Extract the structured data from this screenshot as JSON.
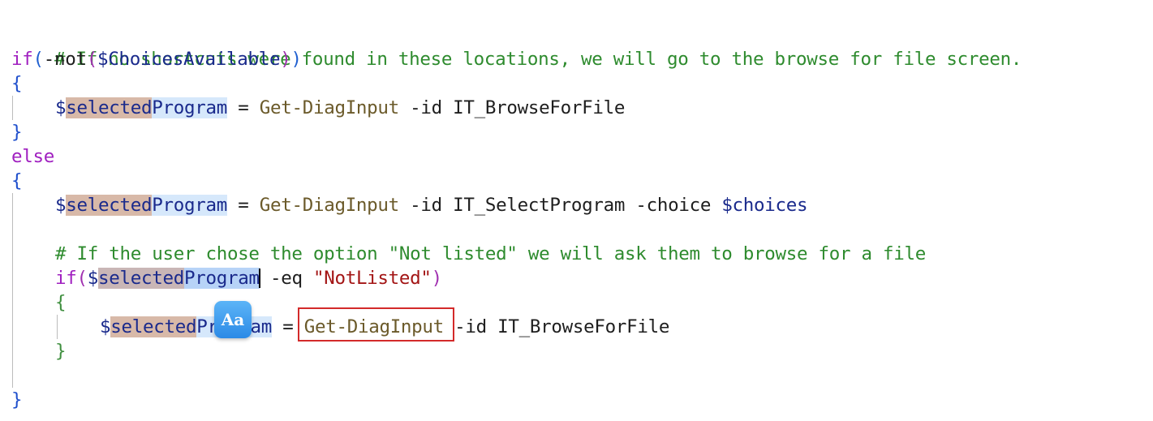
{
  "editor": {
    "lines": {
      "l1": {
        "comment": "# If no shortcuts were found in these locations, we will go to the browse for file screen."
      },
      "l2": {
        "kw": "if",
        "open": "(",
        "op": "-not",
        "open2": "(",
        "var": "$ChoicesAvailable",
        "close2": ")",
        "close": ")"
      },
      "l3": {
        "brace": "{"
      },
      "l4": {
        "sigil": "$",
        "word": "selected",
        "rest": "Program",
        "eq": " = ",
        "func": "Get-DiagInput",
        "args": " -id IT_BrowseForFile"
      },
      "l5": {
        "brace": "}"
      },
      "l6": {
        "kw": "else"
      },
      "l7": {
        "brace": "{"
      },
      "l8": {
        "sigil": "$",
        "word": "selected",
        "rest": "Program",
        "eq": " = ",
        "func": "Get-DiagInput",
        "args": " -id IT_SelectProgram -choice ",
        "var": "$choices"
      },
      "l10": {
        "comment": "# If the user chose the option \"Not listed\" we will ask them to browse for a file"
      },
      "l11": {
        "kw": "if",
        "open": "(",
        "sigil": "$",
        "word": "selected",
        "rest": "Program",
        "op": " -eq ",
        "string": "\"NotListed\"",
        "close": ")"
      },
      "l12": {
        "brace": "{"
      },
      "l13": {
        "sigil": "$",
        "word": "selected",
        "rest": "Program",
        "eq": " = ",
        "func": "Get-DiagInput",
        "args": " -id IT_BrowseForFile"
      },
      "l14": {
        "brace": "}"
      },
      "l16": {
        "brace": "}"
      }
    }
  },
  "match_case_button": {
    "label": "Aa",
    "icon": "match-case-icon"
  },
  "colors": {
    "comment": "#2e8b2e",
    "keyword": "#a020c0",
    "function": "#6b5a2a",
    "variable": "#1a2a8c",
    "string": "#a31515",
    "find_highlight": "#d32a2a",
    "badge": "#2b8ae6"
  }
}
